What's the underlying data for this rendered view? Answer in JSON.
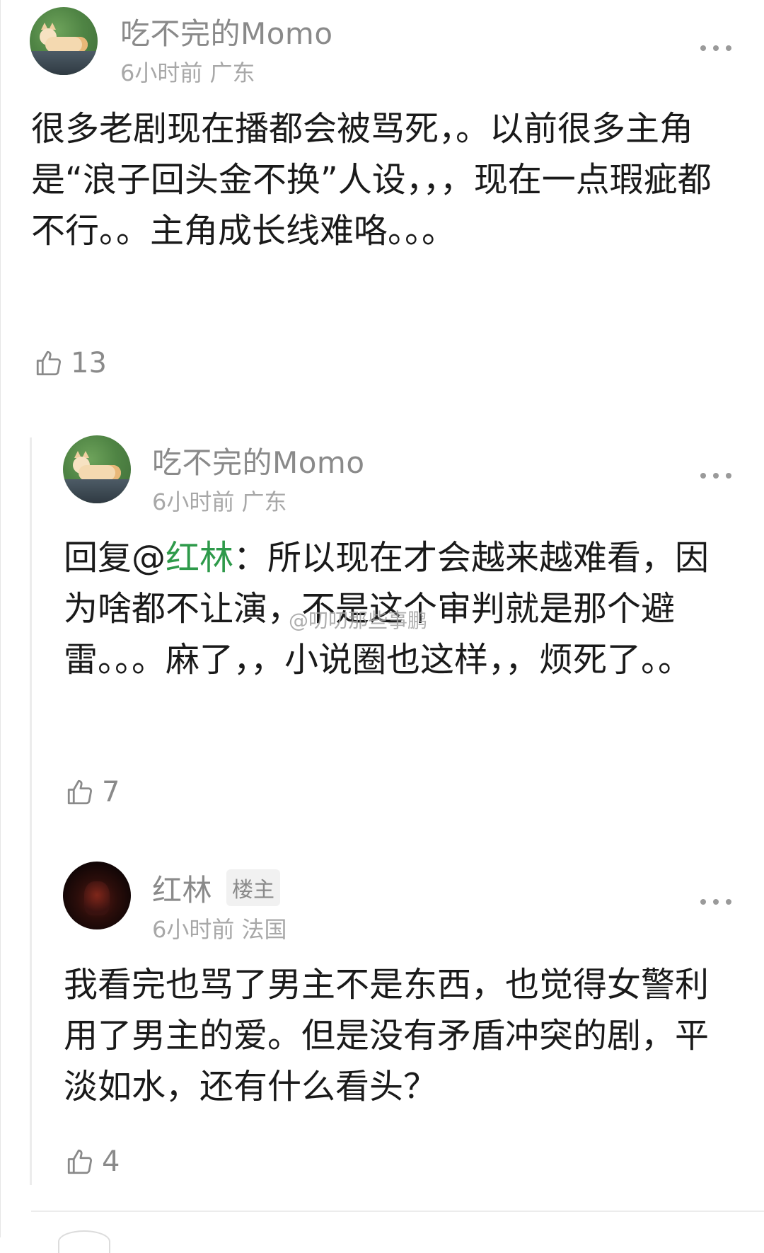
{
  "comments": [
    {
      "username": "吃不完的Momo",
      "meta": "6小时前 广东",
      "text": "很多老剧现在播都会被骂死，。以前很多主角是“浪子回头金不换”人设，，，现在一点瑕疵都不行。。主角成长线难咯。。。",
      "likes": "13",
      "avatar": "cat-avatar"
    }
  ],
  "replies": [
    {
      "username": "吃不完的Momo",
      "meta": "6小时前 广东",
      "reply_prefix": "回复@",
      "reply_to": "红林",
      "reply_sep": "：",
      "text": "所以现在才会越来越难看，因为啥都不让演，不是这个审判就是那个避雷。。。麻了，，小说圈也这样，，烦死了。。",
      "likes": "7",
      "avatar": "cat-avatar"
    },
    {
      "username": "红林",
      "badge": "楼主",
      "meta": "6小时前 法国",
      "text": "我看完也骂了男主不是东西，也觉得女警利用了男主的爱。但是没有矛盾冲突的剧，平淡如水，还有什么看头？",
      "likes": "4",
      "avatar": "dark-avatar"
    }
  ],
  "watermark": "@叨叨那些事鹏",
  "icons": {
    "more": "more-dots-icon",
    "like": "thumbs-up-icon"
  },
  "colors": {
    "mention": "#2e9a4a",
    "text": "#1a1a1a",
    "meta": "#a8a8a8"
  }
}
